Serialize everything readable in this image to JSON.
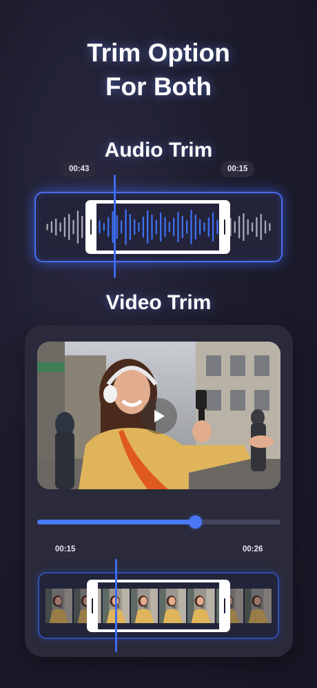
{
  "headline": {
    "line1": "Trim Option",
    "line2": "For Both"
  },
  "audio": {
    "title": "Audio Trim",
    "time_start": "00:43",
    "time_end": "00:15",
    "accent_color": "#4a6cf0",
    "wave_active_color": "#3f6ef0",
    "wave_inactive_color": "#a9a9b8"
  },
  "video": {
    "title": "Video Trim",
    "time_start": "00:15",
    "time_end": "00:26",
    "progress": 0.65,
    "progress_color": "#4a78f5",
    "play_icon": "play-icon"
  },
  "colors": {
    "background": "#1c1c2c",
    "card": "#2a2a3b",
    "pill": "#2b2b3b"
  }
}
